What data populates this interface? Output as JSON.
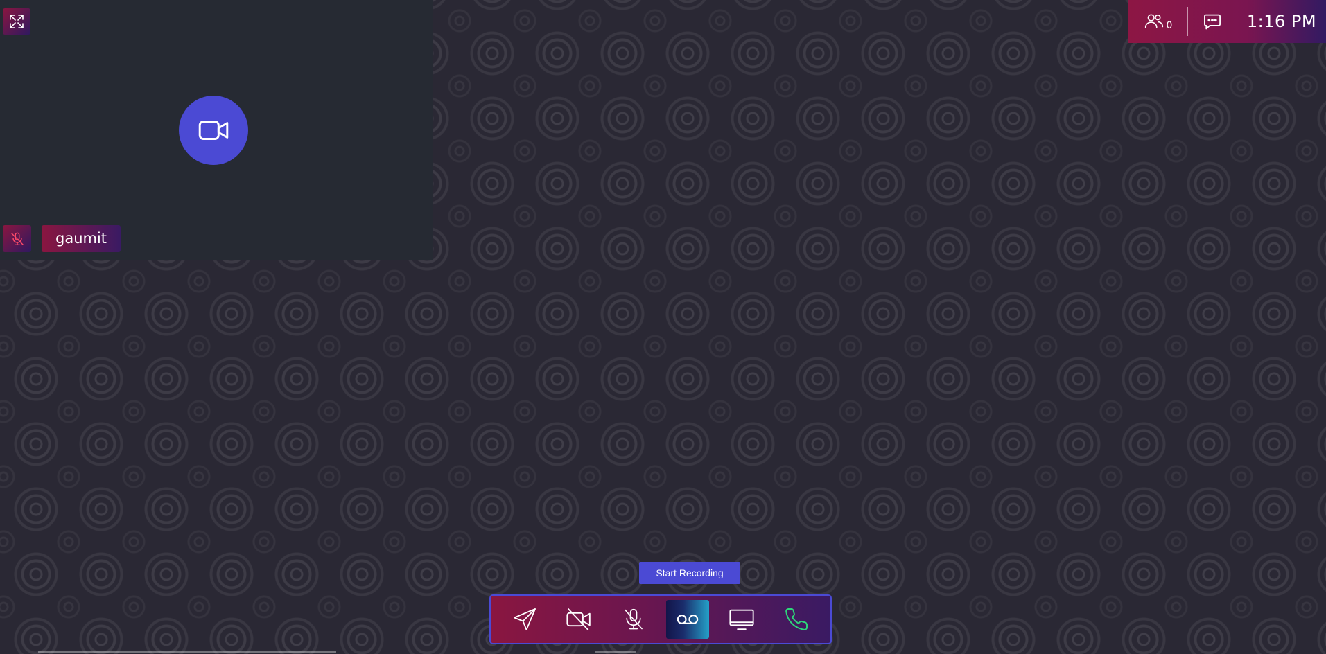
{
  "local_tile": {
    "participant_name": "gaumit",
    "camera_status_icon": "video-camera-icon",
    "mic_status_icon": "mic-off-icon",
    "expand_icon": "expand-icon"
  },
  "top_bar": {
    "participants_icon": "people-icon",
    "participant_count": "0",
    "chat_icon": "chat-bubble-icon",
    "time": "1:16 PM"
  },
  "tooltip": {
    "text": "Start Recording"
  },
  "controls": [
    {
      "name": "send",
      "icon": "send-icon"
    },
    {
      "name": "video-toggle",
      "icon": "video-off-icon"
    },
    {
      "name": "mic-toggle",
      "icon": "mic-off-icon"
    },
    {
      "name": "record",
      "icon": "voicemail-record-icon",
      "active": true
    },
    {
      "name": "screen-share",
      "icon": "monitor-icon"
    },
    {
      "name": "call",
      "icon": "phone-icon"
    }
  ],
  "colors": {
    "brand_crimson": "#8a1640",
    "brand_purple": "#3a1a63",
    "accent_indigo": "#4b4ad4",
    "call_green": "#2ed47a",
    "tile_bg": "#262a33"
  }
}
